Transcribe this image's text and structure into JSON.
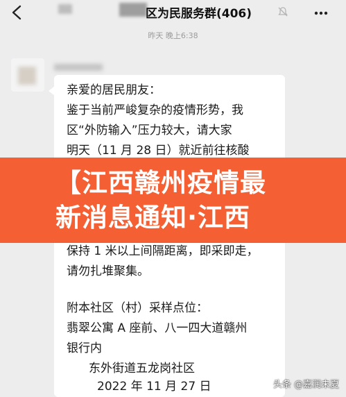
{
  "header": {
    "group_title": "区为民服务群(406)",
    "back_icon": "back-arrow-icon",
    "mute_icon": "bell-muted-icon",
    "more_icon": "more-dots-icon"
  },
  "timestamp": "昨天 晚上6:38",
  "message": {
    "lines": [
      "亲爱的居民朋友：",
      "鉴于当前严峻复杂的疫情形势，我",
      "区“外防输入”压力较大，请大家",
      "明天（11 月 28 日）就近前往核酸",
      "保持 1 米以上间隔距离，即采即走，",
      "请勿扎堆聚集。",
      "附本社区（村）采样点位：",
      "翡翠公寓 A 座前、八一四大道赣州",
      "银行内",
      "东外街道五龙岗社区",
      "2022 年 11 月 27 日"
    ]
  },
  "banner": {
    "line1": "【江西赣州疫情最",
    "line2": "新消息通知·江西",
    "color": "#f46033"
  },
  "watermark": "头条 @嘉润未夏"
}
